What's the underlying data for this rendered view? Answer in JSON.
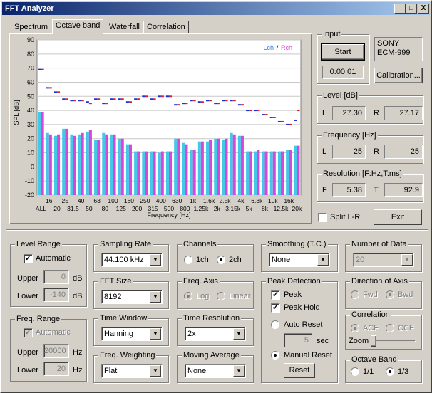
{
  "window": {
    "title": "FFT Analyzer",
    "buttons": {
      "minimize": "_",
      "maximize": "□",
      "close": "X"
    }
  },
  "tabs": [
    "Spectrum",
    "Octave band",
    "Waterfall",
    "Correlation"
  ],
  "chart_data": {
    "type": "bar",
    "ylabel": "SPL [dB]",
    "xlabel": "Frequency [Hz]",
    "ylim": [
      -20,
      90
    ],
    "yticks": [
      -20,
      -10,
      0,
      10,
      20,
      30,
      40,
      50,
      60,
      70,
      80,
      90
    ],
    "grid": true,
    "legend": {
      "placement": "top-right",
      "lch": "Lch",
      "sep": "/",
      "rch": "Rch"
    },
    "colors": {
      "lch": "#44c8e8",
      "rch": "#d848d8",
      "peak_l": "#2030d8",
      "peak_r": "#e02020"
    },
    "categories": [
      "ALL",
      "16",
      "20",
      "25",
      "31.5",
      "40",
      "50",
      "63",
      "80",
      "100",
      "125",
      "160",
      "200",
      "250",
      "315",
      "400",
      "500",
      "630",
      "800",
      "1k",
      "1.25k",
      "1.6k",
      "2k",
      "2.5k",
      "3.15k",
      "4k",
      "5k",
      "6.3k",
      "8k",
      "10k",
      "12.5k",
      "16k",
      "20k"
    ],
    "tick_labels_top": [
      "16",
      "25",
      "40",
      "63",
      "100",
      "160",
      "250",
      "400",
      "630",
      "1k",
      "1.6k",
      "2.5k",
      "4k",
      "6.3k",
      "10k",
      "16k"
    ],
    "tick_labels_bottom": [
      "ALL",
      "20",
      "31.5",
      "50",
      "80",
      "125",
      "200",
      "315",
      "500",
      "800",
      "1.25k",
      "2k",
      "3.15k",
      "5k",
      "8k",
      "12.5k",
      "20k"
    ],
    "series": [
      {
        "name": "Lch",
        "values": [
          39,
          24,
          22,
          27,
          23,
          23,
          25,
          19,
          24,
          23,
          20,
          16,
          11,
          11,
          11,
          10,
          11,
          20,
          17,
          12,
          18,
          18,
          20,
          19,
          24,
          22,
          11,
          11,
          11,
          11,
          11,
          12,
          15
        ]
      },
      {
        "name": "Rch",
        "values": [
          39,
          23,
          23,
          27,
          22,
          24,
          26,
          19,
          23,
          23,
          20,
          16,
          11,
          11,
          11,
          11,
          11,
          20,
          16,
          12,
          18,
          19,
          20,
          20,
          23,
          22,
          11,
          12,
          11,
          11,
          11,
          12,
          15
        ]
      }
    ],
    "peak_hold": {
      "lch": [
        69,
        56,
        53,
        48,
        47,
        47,
        46,
        48,
        45,
        48,
        48,
        46,
        48,
        50,
        48,
        50,
        50,
        44,
        45,
        47,
        46,
        47,
        45,
        47,
        47,
        44,
        40,
        40,
        37,
        35,
        32,
        30,
        33
      ],
      "rch": [
        69,
        56,
        53,
        48,
        47,
        47,
        45,
        48,
        45,
        48,
        48,
        46,
        48,
        50,
        48,
        50,
        50,
        44,
        45,
        47,
        46,
        47,
        45,
        47,
        47,
        44,
        40,
        40,
        37,
        35,
        32,
        30,
        40
      ]
    }
  },
  "input": {
    "label": "Input",
    "start": "Start",
    "time": "0:00:01",
    "device_line1": "SONY",
    "device_line2": "ECM-999",
    "calibration": "Calibration..."
  },
  "level": {
    "label": "Level [dB]",
    "l_label": "L",
    "l_value": "27.30",
    "r_label": "R",
    "r_value": "27.17"
  },
  "frequency": {
    "label": "Frequency [Hz]",
    "l_label": "L",
    "l_value": "25",
    "r_label": "R",
    "r_value": "25"
  },
  "resolution": {
    "label": "Resolution [F:Hz,T:ms]",
    "f_label": "F",
    "f_value": "5.38",
    "t_label": "T",
    "t_value": "92.9"
  },
  "split": {
    "label": "Split L-R",
    "checked": false
  },
  "exit": "Exit",
  "level_range": {
    "label": "Level Range",
    "automatic": "Automatic",
    "upper_label": "Upper",
    "upper_value": "0",
    "upper_unit": "dB",
    "lower_label": "Lower",
    "lower_value": "-140",
    "lower_unit": "dB"
  },
  "freq_range": {
    "label": "Freq. Range",
    "automatic": "Automatic",
    "upper_label": "Upper",
    "upper_value": "20000",
    "upper_unit": "Hz",
    "lower_label": "Lower",
    "lower_value": "20",
    "lower_unit": "Hz"
  },
  "sampling_rate": {
    "label": "Sampling Rate",
    "value": "44.100 kHz"
  },
  "fft_size": {
    "label": "FFT Size",
    "value": "8192"
  },
  "time_window": {
    "label": "Time Window",
    "value": "Hanning"
  },
  "freq_weighting": {
    "label": "Freq. Weighting",
    "value": "Flat"
  },
  "channels": {
    "label": "Channels",
    "opt1": "1ch",
    "opt2": "2ch"
  },
  "freq_axis": {
    "label": "Freq. Axis",
    "opt1": "Log",
    "opt2": "Linear"
  },
  "time_resolution": {
    "label": "Time Resolution",
    "value": "2x"
  },
  "moving_average": {
    "label": "Moving Average",
    "value": "None"
  },
  "smoothing": {
    "label": "Smoothing (T.C.)",
    "value": "None"
  },
  "peak_detection": {
    "label": "Peak Detection",
    "peak": "Peak",
    "peak_hold": "Peak Hold",
    "auto_reset": "Auto Reset",
    "sec_value": "5",
    "sec_unit": "sec",
    "manual_reset": "Manual Reset",
    "reset": "Reset"
  },
  "number_of_data": {
    "label": "Number of Data",
    "value": "20"
  },
  "direction_of_axis": {
    "label": "Direction of Axis",
    "opt1": "Fwd",
    "opt2": "Bwd"
  },
  "correlation": {
    "label": "Correlation",
    "opt1": "ACF",
    "opt2": "CCF",
    "zoom": "Zoom"
  },
  "octave_band": {
    "label": "Octave Band",
    "opt1": "1/1",
    "opt2": "1/3"
  }
}
